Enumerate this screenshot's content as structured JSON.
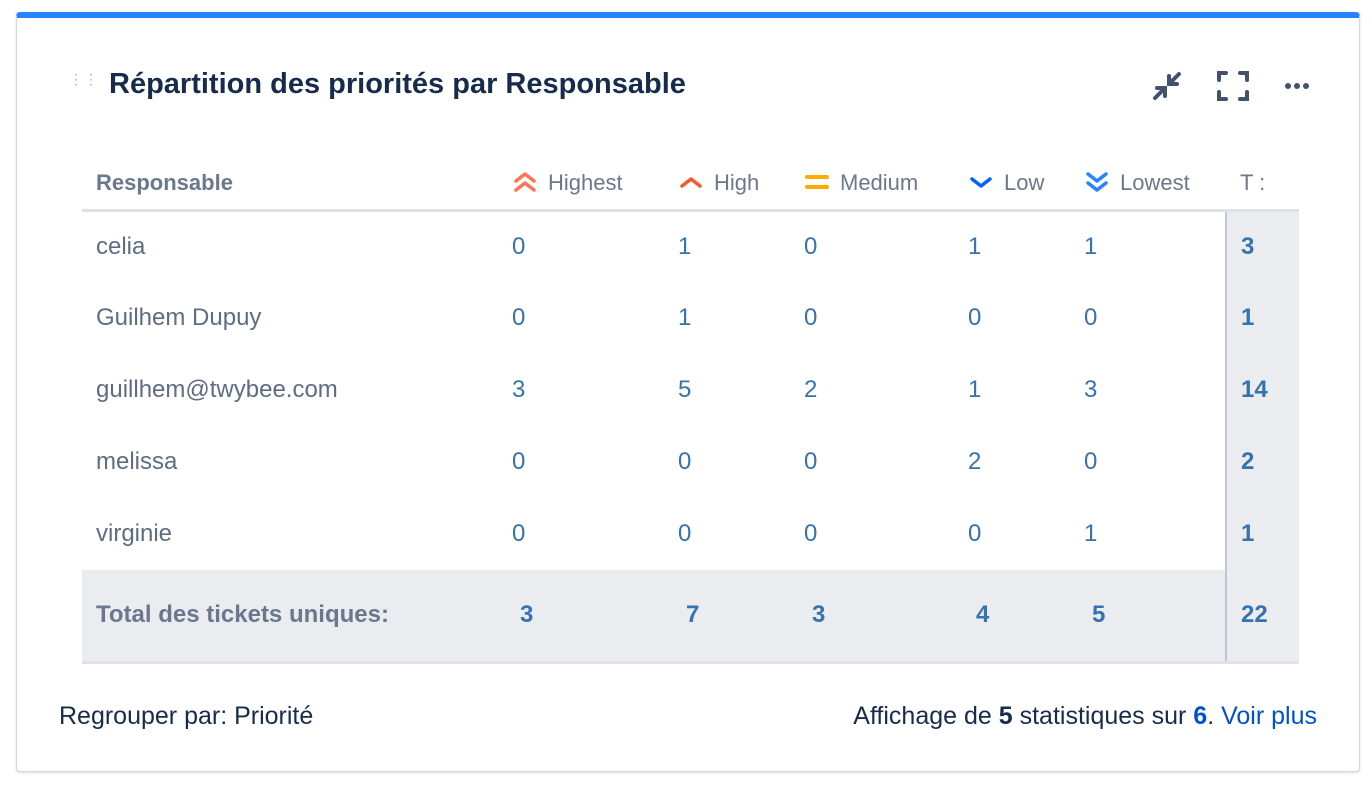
{
  "title": "Répartition des priorités par Responsable",
  "icons": {
    "collapse": "minimize-icon",
    "fullscreen": "fullscreen-icon",
    "more": "more-icon",
    "drag": "drag-handle-icon"
  },
  "table": {
    "headers": {
      "name": "Responsable",
      "highest": "Highest",
      "high": "High",
      "medium": "Medium",
      "low": "Low",
      "lowest": "Lowest",
      "total": "T :"
    },
    "priority_colors": {
      "highest": "#ff7452",
      "high": "#ff5630",
      "medium": "#ffab00",
      "low": "#0065ff",
      "lowest": "#2684ff"
    },
    "rows": [
      {
        "name": "celia",
        "values": [
          "0",
          "1",
          "0",
          "1",
          "1"
        ],
        "total": "3"
      },
      {
        "name": "Guilhem Dupuy",
        "values": [
          "0",
          "1",
          "0",
          "0",
          "0"
        ],
        "total": "1"
      },
      {
        "name": "guillhem@twybee.com",
        "values": [
          "3",
          "5",
          "2",
          "1",
          "3"
        ],
        "total": "14"
      },
      {
        "name": "melissa",
        "values": [
          "0",
          "0",
          "0",
          "2",
          "0"
        ],
        "total": "2"
      },
      {
        "name": "virginie",
        "values": [
          "0",
          "0",
          "0",
          "0",
          "1"
        ],
        "total": "1"
      }
    ],
    "totals": {
      "label": "Total des tickets uniques:",
      "values": [
        "3",
        "7",
        "3",
        "4",
        "5"
      ],
      "total": "22"
    }
  },
  "footer": {
    "group_by": "Regrouper par: Priorité",
    "showing_prefix": "Affichage de ",
    "shown": "5",
    "showing_mid": " statistiques sur ",
    "of": "6",
    "showing_suffix": ". ",
    "see_more": "Voir plus"
  }
}
